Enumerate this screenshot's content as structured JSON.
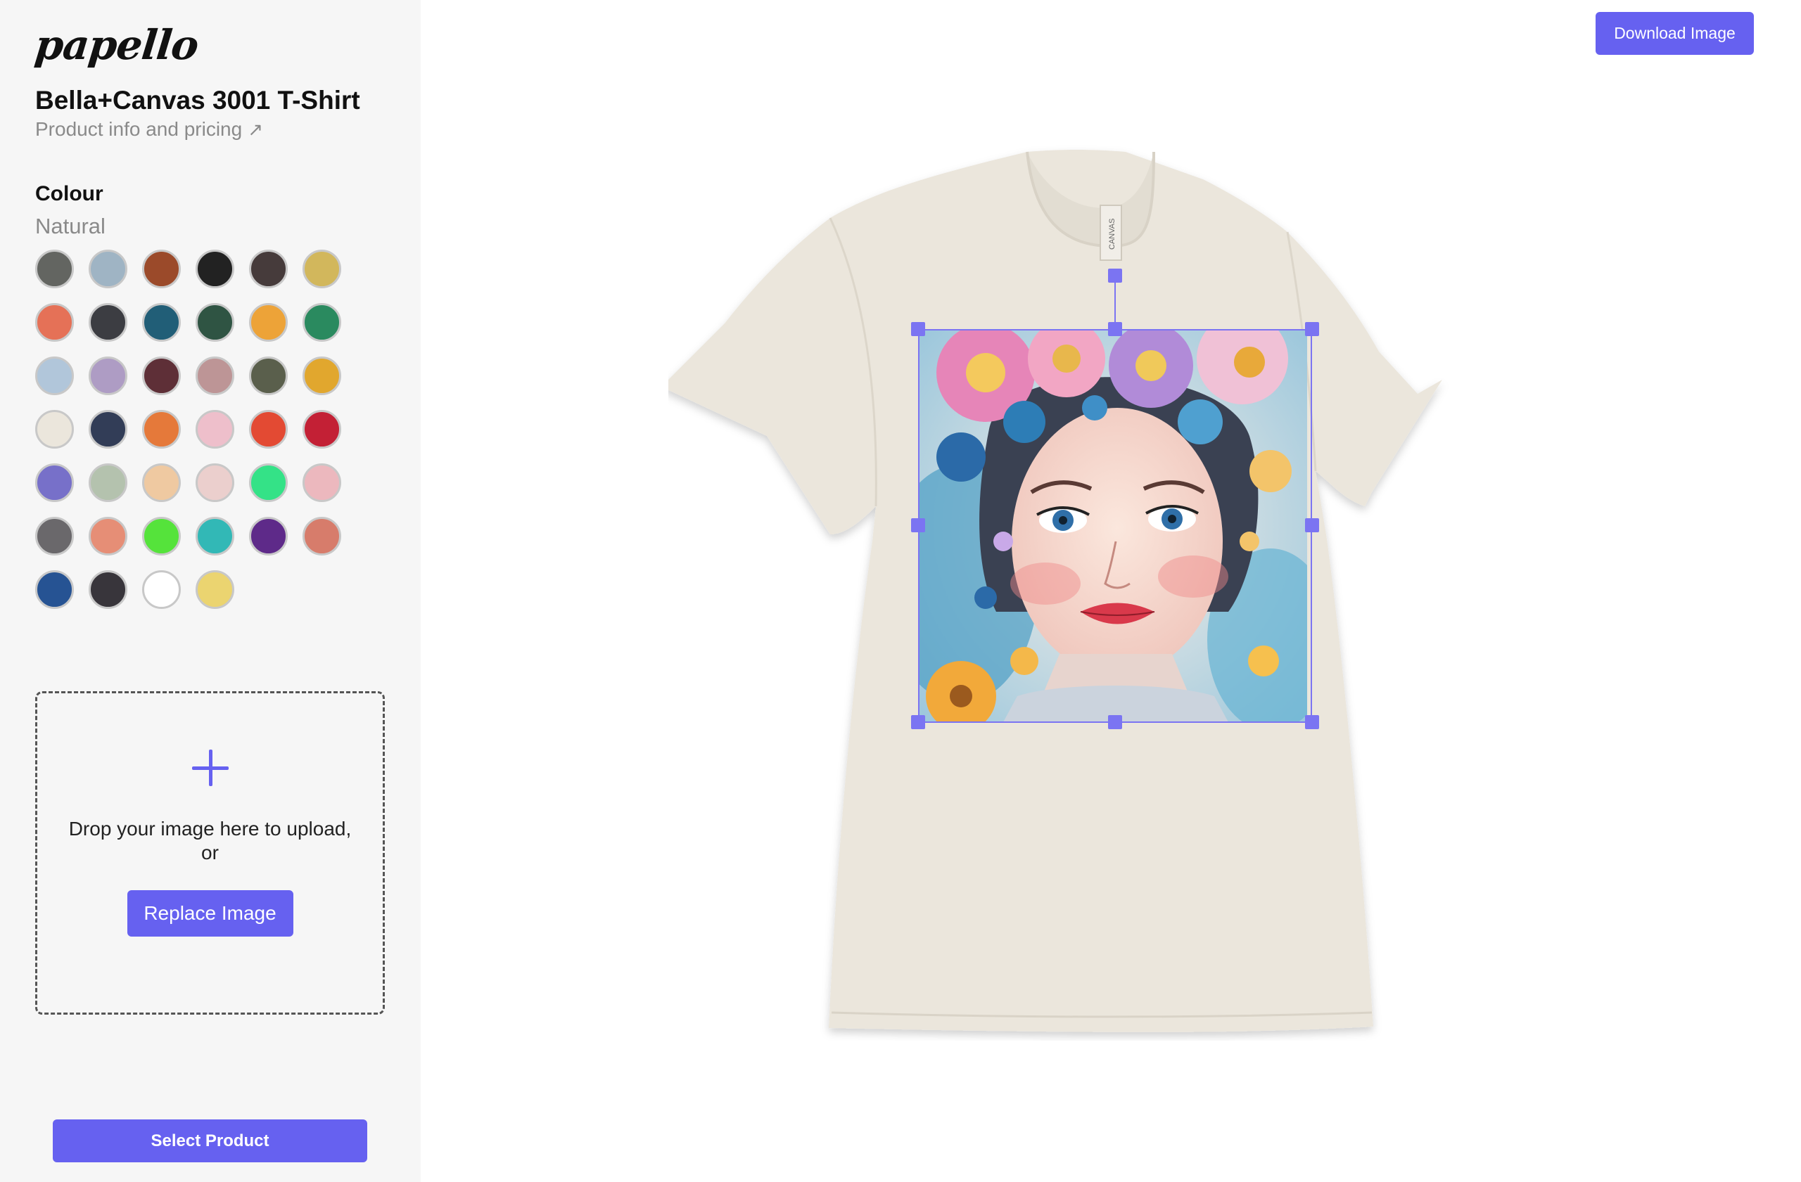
{
  "brand": {
    "logo_text": "papello"
  },
  "product": {
    "title": "Bella+Canvas 3001 T-Shirt",
    "info_link": "Product info and pricing",
    "info_link_icon": "external-arrow-icon"
  },
  "colour": {
    "heading": "Colour",
    "selected_name": "Natural",
    "swatches": [
      "#636561",
      "#9fb4c4",
      "#9b4a2a",
      "#222222",
      "#463b3b",
      "#d2b75c",
      "#e57157",
      "#3c3d42",
      "#215e77",
      "#2f5443",
      "#eda338",
      "#2a8a5f",
      "#b1c6da",
      "#ae9cc4",
      "#5e2f37",
      "#bd9596",
      "#5a5f4c",
      "#e1a72e",
      "#ebe6dc",
      "#323d57",
      "#e5793a",
      "#eebfcb",
      "#e34a33",
      "#c32035",
      "#7770c9",
      "#b4c2ae",
      "#efc9a1",
      "#ebcfcd",
      "#34e287",
      "#ecb8be",
      "#6a686b",
      "#e68e76",
      "#55e33b",
      "#32b8b6",
      "#5e2a89",
      "#d77c6b",
      "#265393",
      "#38353b",
      "#ffffff",
      "#ebd470"
    ]
  },
  "upload": {
    "plus_icon": "plus-icon",
    "drop_text": "Drop your image here to upload, or",
    "replace_label": "Replace Image"
  },
  "footer": {
    "select_label": "Select Product"
  },
  "toolbar": {
    "download_label": "Download Image"
  },
  "preview": {
    "garment_color": "#ebe6dc",
    "design_image": "floral-portrait-artwork",
    "accent": "#6661f0"
  }
}
